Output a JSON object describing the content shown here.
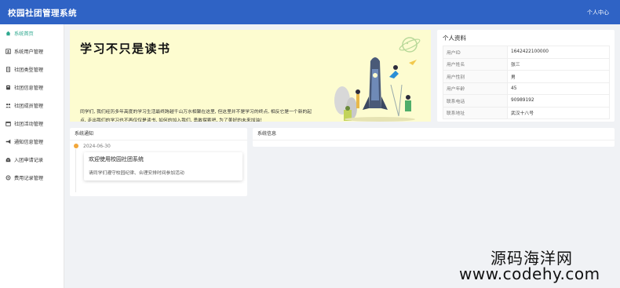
{
  "app": {
    "title": "校园社团管理系统",
    "user_menu": "个人中心"
  },
  "colors": {
    "topbar": "#2f63c5",
    "accent": "#2ea88f",
    "dot": "#f2a73b"
  },
  "sidebar": {
    "items": [
      {
        "label": "系统首页",
        "icon": "home-icon",
        "active": true
      },
      {
        "label": "系统用户管理",
        "icon": "user-card-icon"
      },
      {
        "label": "社团类型管理",
        "icon": "document-icon"
      },
      {
        "label": "社团信息管理",
        "icon": "building-icon"
      },
      {
        "label": "社团成员管理",
        "icon": "people-icon"
      },
      {
        "label": "社团活动管理",
        "icon": "calendar-icon"
      },
      {
        "label": "通知信息管理",
        "icon": "megaphone-icon"
      },
      {
        "label": "入团申请记录",
        "icon": "inbox-icon"
      },
      {
        "label": "费用记录管理",
        "icon": "gear-icon"
      }
    ]
  },
  "banner": {
    "headline": "学习不只是读书",
    "paragraph": "同学们, 我们经历多年高度的学习生活最终跨越千山万水相聚在这里, 但这里并不是学习的终点, 相反它是一个新的起点, 走出我们的学习也不再仅仅是读书, 如何的加入我们, 勇敢探索吧, 为了美好的未来加油!"
  },
  "profile": {
    "title": "个人资料",
    "rows": [
      {
        "key": "用户ID",
        "value": "1642422100000"
      },
      {
        "key": "用户姓名",
        "value": "张三"
      },
      {
        "key": "用户性别",
        "value": "男"
      },
      {
        "key": "用户年龄",
        "value": "45"
      },
      {
        "key": "联系电话",
        "value": "90989192"
      },
      {
        "key": "联系地址",
        "value": "武汉十八号"
      }
    ]
  },
  "notice": {
    "title": "系统通知",
    "date": "2024-06-30",
    "card_title": "欢迎使用校园社团系统",
    "card_body": "请同学们遵守校园纪律、合理安排时间参加活动"
  },
  "sysinfo": {
    "title": "系统信息"
  },
  "watermark": {
    "line1": "源码海洋网",
    "line2": "www.codehy.com"
  }
}
